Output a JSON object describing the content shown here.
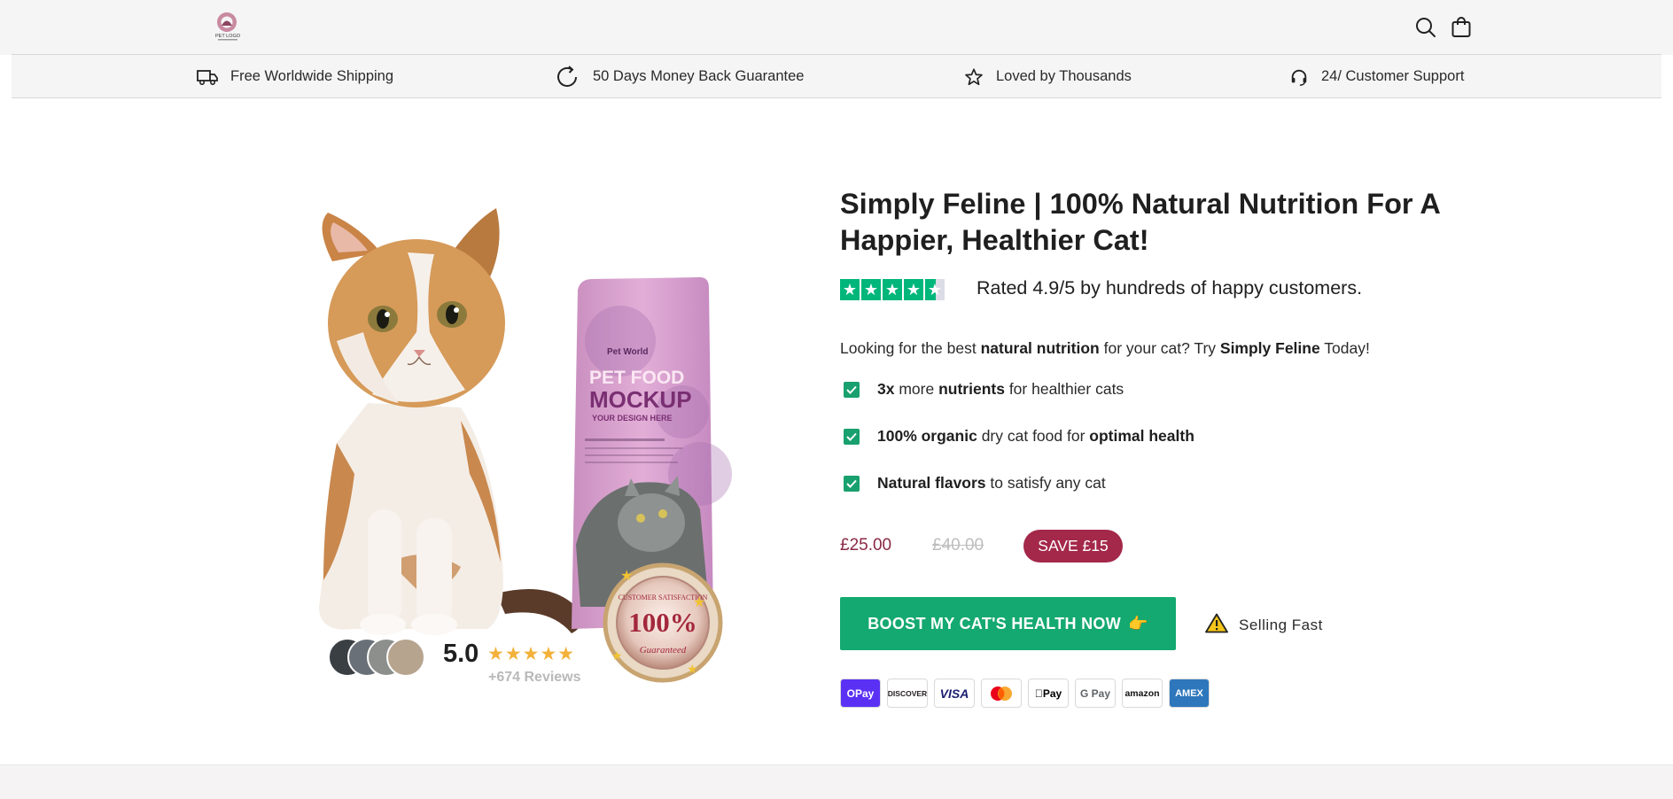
{
  "header": {
    "logo_text": "PET LOGO",
    "icons": [
      "search-icon",
      "cart-icon"
    ]
  },
  "usp_bar": [
    {
      "icon": "truck-icon",
      "label": "Free Worldwide Shipping"
    },
    {
      "icon": "refresh-icon",
      "label": "50 Days Money Back Guarantee"
    },
    {
      "icon": "star-outline-icon",
      "label": "Loved by Thousands"
    },
    {
      "icon": "headset-icon",
      "label": "24/ Customer Support"
    }
  ],
  "media": {
    "bag": {
      "brand": "Pet World",
      "headline_1": "PET FOOD",
      "headline_2": "MOCKUP",
      "tagline": "YOUR DESIGN HERE"
    },
    "seal": {
      "value": "100%",
      "top_text": "CUSTOMER SATISFACTION",
      "bottom_text": "Guaranteed"
    },
    "social_proof": {
      "score": "5.0",
      "stars": "★★★★★",
      "reviews": "+674 Reviews"
    }
  },
  "product": {
    "title": "Simply Feline | 100% Natural Nutrition For A Happier, Healthier Cat!",
    "rating_stars": 4.5,
    "rating_text": "Rated 4.9/5 by hundreds of happy customers.",
    "intro": {
      "p1": "Looking for the best ",
      "b1": "natural nutrition",
      "p2": " for your cat? Try ",
      "b2": "Simply Feline",
      "p3": " Today!"
    },
    "benefits": [
      {
        "b1": "3x",
        "p1": " more ",
        "b2": "nutrients",
        "p2": " for healthier cats"
      },
      {
        "b1": "100% organic",
        "p1": " dry cat food for ",
        "b2": "optimal health",
        "p2": ""
      },
      {
        "b1": "Natural flavors",
        "p1": " to satisfy any cat",
        "b2": "",
        "p2": ""
      }
    ],
    "price": "£25.00",
    "compare_price": "£40.00",
    "save_badge": "SAVE £15",
    "cta_label": "BOOST MY CAT'S HEALTH NOW",
    "cta_emoji": "👉",
    "urgency": "Selling Fast",
    "payment_methods": [
      {
        "name": "OPay",
        "color": "#5a31f4",
        "text_color": "#ffffff"
      },
      {
        "name": "DISCOVER",
        "color": "#ffffff",
        "text_color": "#231f20"
      },
      {
        "name": "VISA",
        "color": "#ffffff",
        "text_color": "#1a1f71"
      },
      {
        "name": "mastercard",
        "color": "#ffffff",
        "text_color": "#eb001b"
      },
      {
        "name": "Pay",
        "color": "#ffffff",
        "text_color": "#000000"
      },
      {
        "name": "G Pay",
        "color": "#ffffff",
        "text_color": "#5f6368"
      },
      {
        "name": "amazon",
        "color": "#ffffff",
        "text_color": "#111111"
      },
      {
        "name": "AMEX",
        "color": "#2e77bc",
        "text_color": "#ffffff"
      }
    ]
  },
  "colors": {
    "accent_green": "#14a970",
    "trustpilot_green": "#00b67a",
    "price": "#8a2a44",
    "badge": "#a3284a",
    "star_gold": "#f3b13b"
  }
}
